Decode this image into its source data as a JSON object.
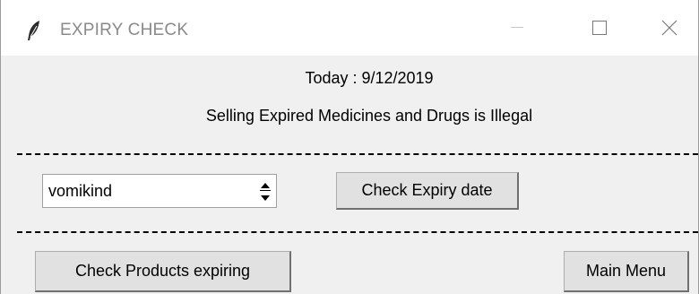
{
  "window": {
    "title": "EXPIRY CHECK",
    "controls": {
      "minimize": "minimize-icon",
      "maximize": "maximize-icon",
      "close": "close-icon"
    }
  },
  "header": {
    "today_label": "Today : 9/12/2019",
    "warning": "Selling Expired Medicines and Drugs is Illegal"
  },
  "product_selector": {
    "value": "vomikind"
  },
  "buttons": {
    "check_expiry_date": "Check Expiry date",
    "check_products_expiring": "Check Products expiring",
    "main_menu": "Main Menu"
  },
  "colors": {
    "window_bg": "#f0f0f0",
    "titlebar_bg": "#ffffff",
    "title_text": "#8a8a8a",
    "button_bg": "#e1e1e1"
  }
}
